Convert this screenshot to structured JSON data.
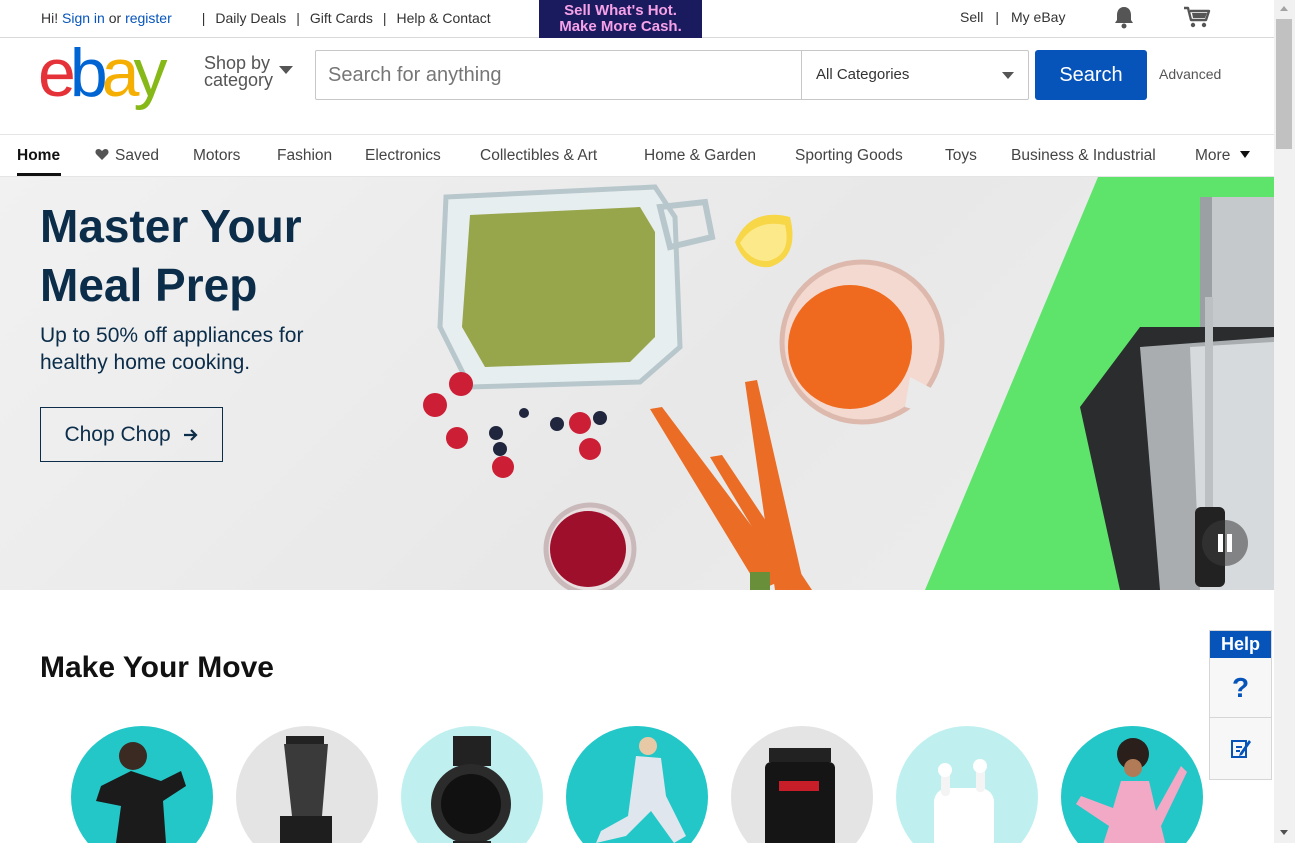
{
  "topbar": {
    "greeting": "Hi!",
    "sign_in": "Sign in",
    "or": "or",
    "register": "register",
    "links": [
      "Daily Deals",
      "Gift Cards",
      "Help & Contact"
    ],
    "promo_line1": "Sell What's Hot.",
    "promo_line2": "Make More Cash.",
    "sell": "Sell",
    "my_ebay": "My eBay",
    "icons": [
      "bell-icon",
      "cart-icon"
    ]
  },
  "header": {
    "logo_letters": [
      "e",
      "b",
      "a",
      "y"
    ],
    "shop_by_line1": "Shop by",
    "shop_by_line2": "category",
    "search_placeholder": "Search for anything",
    "search_value": "",
    "category_selected": "All Categories",
    "search_button": "Search",
    "advanced": "Advanced"
  },
  "nav": {
    "items": [
      "Home",
      "Saved",
      "Motors",
      "Fashion",
      "Electronics",
      "Collectibles & Art",
      "Home & Garden",
      "Sporting Goods",
      "Toys",
      "Business & Industrial",
      "More"
    ],
    "active": "Home"
  },
  "hero": {
    "title": "Master Your Meal Prep",
    "subtitle": "Up to 50% off appliances for healthy home cooking.",
    "button": "Chop Chop",
    "button_icon": "arrow-right-icon",
    "accent_color": "#5ee46a",
    "text_color": "#0b2d4a"
  },
  "section": {
    "title": "Make Your Move",
    "circles": [
      "adidas-jacket",
      "blender",
      "smartwatch",
      "yoga-pose",
      "protein-powder",
      "airpods",
      "yoga-jump"
    ]
  },
  "help_widget": {
    "title": "Help",
    "question_mark": "?",
    "icons": [
      "question-icon",
      "feedback-icon"
    ]
  },
  "colors": {
    "link_blue": "#0654ba",
    "logo_red": "#e53238",
    "logo_blue": "#0064d2",
    "logo_yellow": "#f5af02",
    "logo_green": "#86b817"
  }
}
